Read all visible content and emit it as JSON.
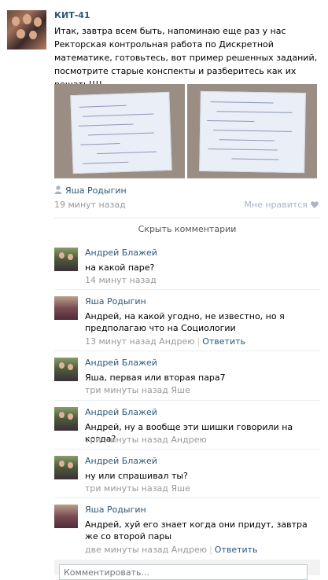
{
  "post": {
    "title": "КИТ-41",
    "text": "Итак, завтра всем быть, напоминаю еще раз у нас Ректорская контрольная работа по Дискретной математике, готовьтесь, вот пример решенных заданий, посмотрите старые конспекты и разберитесь как их решать!!!!",
    "author": "Яша Родыгин",
    "time": "19 минут назад",
    "like_label": "Мне нравится"
  },
  "comments_toggle": "Скрыть комментарии",
  "comments": [
    {
      "name": "Андрей Блажей",
      "text": "на какой паре?",
      "time": "14 минут назад",
      "reply": ""
    },
    {
      "name": "Яша Родыгин",
      "text": "Андрей, на какой угодно, не известно, но я предполагаю что на Социологии",
      "time": "13 минут назад Андрею",
      "reply": "Ответить"
    },
    {
      "name": "Андрей Блажей",
      "text": "Яша, первая или вторая пара7",
      "time": "три минуты назад Яше",
      "reply": ""
    },
    {
      "name": "Андрей Блажей",
      "text": "Андрей, ну а вообще эти шишки говорили на когда?",
      "time": "три минуты назад Андрею",
      "reply": ""
    },
    {
      "name": "Андрей Блажей",
      "text": "ну или спрашивал ты?",
      "time": "три минуты назад Яше",
      "reply": ""
    },
    {
      "name": "Яша Родыгин",
      "text": "Андрей, хуй его знает когда они придут, завтра же со второй пары",
      "time": "две минуты назад Андрею",
      "reply": "Ответить"
    }
  ],
  "comment_input": {
    "placeholder": "Комментировать..."
  },
  "colors": {
    "link": "#2b587a",
    "meta": "#999999",
    "divider": "#edeef0"
  }
}
